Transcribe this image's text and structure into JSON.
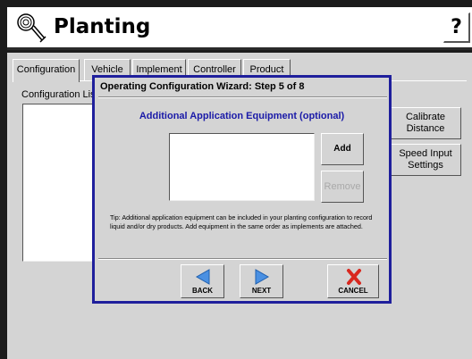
{
  "app": {
    "title": "Planting",
    "help_label": "?"
  },
  "tabs": [
    {
      "label": "Configuration",
      "active": true
    },
    {
      "label": "Vehicle"
    },
    {
      "label": "Implement"
    },
    {
      "label": "Controller"
    },
    {
      "label": "Product"
    }
  ],
  "config_panel": {
    "list_label": "Configuration Lis",
    "calibrate_label": "Calibrate Distance",
    "speed_input_label": "Speed Input Settings"
  },
  "wizard": {
    "title": "Operating Configuration Wizard:  Step 5 of 8",
    "heading": "Additional Application Equipment (optional)",
    "add_label": "Add",
    "remove_label": "Remove",
    "tip": "Tip:  Additional application equipment can be included in your planting configuration to record liquid and/or dry products.  Add equipment in the same order as implements are attached.",
    "back_label": "BACK",
    "next_label": "NEXT",
    "cancel_label": "CANCEL"
  },
  "colors": {
    "accent_blue": "#1f1f9c",
    "heading_blue": "#1a1aa8",
    "arrow_blue": "#4a90e2",
    "cancel_red": "#d9281f"
  },
  "icons": {
    "app": "planting-seed-icon",
    "back": "back-arrow-icon",
    "next": "next-arrow-icon",
    "cancel": "cancel-x-icon"
  }
}
